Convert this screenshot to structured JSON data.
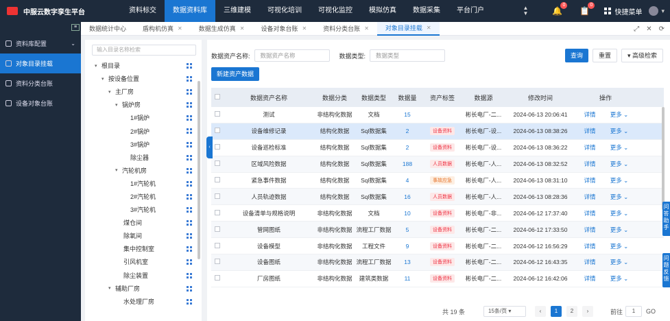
{
  "app": {
    "title": "中服云数字孪生平台"
  },
  "nav": [
    "资料标交",
    "数据资料库",
    "三维建模",
    "可视化培训",
    "可视化监控",
    "模拟仿真",
    "数据采集",
    "平台门户"
  ],
  "header": {
    "badge1": "0",
    "badge2": "0",
    "quick_menu": "快捷菜单",
    "user": ""
  },
  "sidebar": {
    "items": [
      {
        "label": "资料库配置"
      },
      {
        "label": "对象目录挂载"
      },
      {
        "label": "资料分类台账"
      },
      {
        "label": "设备对象台账"
      }
    ]
  },
  "tabs": [
    "数据统计中心",
    "盾构机仿真",
    "数据生成仿真",
    "设备对象台账",
    "资料分类台账",
    "对象目录挂载"
  ],
  "tree": {
    "search_placeholder": "输入目录名称检索",
    "nodes": [
      {
        "label": "根目录"
      },
      {
        "label": "按设备位置"
      },
      {
        "label": "主厂房"
      },
      {
        "label": "锅炉房"
      },
      {
        "label": "1#锅炉"
      },
      {
        "label": "2#锅炉"
      },
      {
        "label": "3#锅炉"
      },
      {
        "label": "除尘器"
      },
      {
        "label": "汽轮机房"
      },
      {
        "label": "1#汽轮机"
      },
      {
        "label": "2#汽轮机"
      },
      {
        "label": "3#汽轮机"
      },
      {
        "label": "煤仓间"
      },
      {
        "label": "除氧间"
      },
      {
        "label": "集中控制室"
      },
      {
        "label": "引风机室"
      },
      {
        "label": "除尘装置"
      },
      {
        "label": "辅助厂房"
      },
      {
        "label": "水处理厂房"
      }
    ]
  },
  "filters": {
    "name_label": "数据资产名称:",
    "name_placeholder": "数据资产名称",
    "type_label": "数据类型:",
    "type_placeholder": "数据类型",
    "search_btn": "查询",
    "reset_btn": "重置",
    "advanced_btn": "▾ 高级检索",
    "new_btn": "新建资产数据"
  },
  "table": {
    "columns": [
      "数据资产名称",
      "数据分类",
      "数据类型",
      "数据量",
      "资产标签",
      "数据源",
      "修改时间",
      "操作"
    ],
    "rows": [
      {
        "name": "测试",
        "cat": "非结构化数据",
        "type": "文档",
        "count": "15",
        "tag": "",
        "source": "彬长电厂-二...",
        "time": "2024-06-13 20:06:41",
        "detail": "详情",
        "more": "更多"
      },
      {
        "name": "设备维修记录",
        "cat": "结构化数据",
        "type": "Sql数据集",
        "count": "2",
        "tag": "设备资料",
        "source": "彬长电厂-设...",
        "time": "2024-06-13 08:38:26",
        "detail": "详情",
        "more": "更多"
      },
      {
        "name": "设备巡检标准",
        "cat": "结构化数据",
        "type": "Sql数据集",
        "count": "2",
        "tag": "设备资料",
        "source": "彬长电厂-设...",
        "time": "2024-06-13 08:36:22",
        "detail": "详情",
        "more": "更多"
      },
      {
        "name": "区域风险数据",
        "cat": "结构化数据",
        "type": "Sql数据集",
        "count": "188",
        "tag": "人员数据",
        "source": "彬长电厂-人...",
        "time": "2024-06-13 08:32:52",
        "detail": "详情",
        "more": "更多"
      },
      {
        "name": "紧急事件数据",
        "cat": "结构化数据",
        "type": "Sql数据集",
        "count": "4",
        "tag": "事故应急",
        "source": "彬长电厂-人...",
        "time": "2024-06-13 08:31:10",
        "detail": "详情",
        "more": "更多"
      },
      {
        "name": "人员轨迹数据",
        "cat": "结构化数据",
        "type": "Sql数据集",
        "count": "16",
        "tag": "人员数据",
        "source": "彬长电厂-人...",
        "time": "2024-06-13 08:28:36",
        "detail": "详情",
        "more": "更多"
      },
      {
        "name": "设备清单与规格说明",
        "cat": "非结构化数据",
        "type": "文档",
        "count": "10",
        "tag": "设备资料",
        "source": "彬长电厂-非...",
        "time": "2024-06-12 17:37:40",
        "detail": "详情",
        "more": "更多"
      },
      {
        "name": "管网图纸",
        "cat": "非结构化数据",
        "type": "流程工厂数据",
        "count": "5",
        "tag": "设备资料",
        "source": "彬长电厂-二...",
        "time": "2024-06-12 17:33:50",
        "detail": "详情",
        "more": "更多"
      },
      {
        "name": "设备模型",
        "cat": "非结构化数据",
        "type": "工程文件",
        "count": "9",
        "tag": "设备资料",
        "source": "彬长电厂-二...",
        "time": "2024-06-12 16:56:29",
        "detail": "详情",
        "more": "更多"
      },
      {
        "name": "设备图纸",
        "cat": "非结构化数据",
        "type": "流程工厂数据",
        "count": "13",
        "tag": "设备资料",
        "source": "彬长电厂-二...",
        "time": "2024-06-12 16:43:35",
        "detail": "详情",
        "more": "更多"
      },
      {
        "name": "厂房图纸",
        "cat": "非结构化数据",
        "type": "建筑类数据",
        "count": "11",
        "tag": "设备资料",
        "source": "彬长电厂-二...",
        "time": "2024-06-12 16:42:06",
        "detail": "详情",
        "more": "更多"
      }
    ]
  },
  "pager": {
    "total": "共 19 条",
    "size": "15条/页",
    "page1": "1",
    "page2": "2",
    "goto": "前往",
    "goto_value": "1",
    "go": "GO"
  },
  "float_tabs": [
    "问答助手",
    "问题反馈"
  ],
  "colors": {
    "accent": "#1a76d2",
    "topbar": "#1e2b3c",
    "tag_red": "#e34",
    "tag_orange": "#e7732a"
  }
}
